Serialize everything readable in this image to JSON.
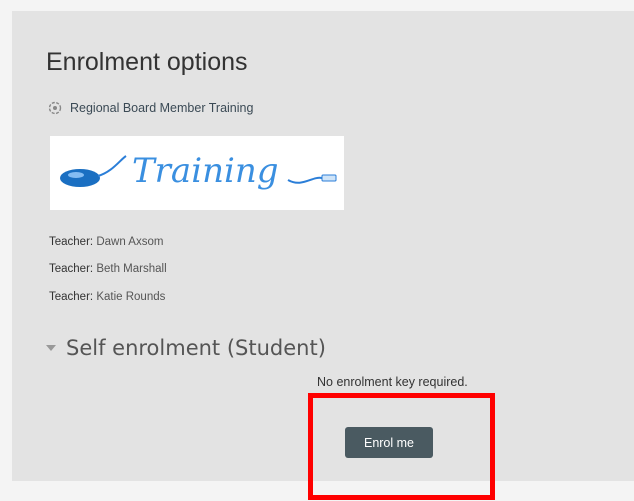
{
  "page": {
    "title": "Enrolment options"
  },
  "course": {
    "name": "Regional Board Member Training",
    "image_text": "Training"
  },
  "teachers": [
    {
      "role": "Teacher:",
      "name": "Dawn Axsom"
    },
    {
      "role": "Teacher:",
      "name": "Beth Marshall"
    },
    {
      "role": "Teacher:",
      "name": "Katie Rounds"
    }
  ],
  "self_enrolment": {
    "heading": "Self enrolment (Student)",
    "note": "No enrolment key required.",
    "button_label": "Enrol me"
  },
  "colors": {
    "button_bg": "#4a5a61",
    "highlight": "#ff0000",
    "panel_bg": "#e3e3e3"
  }
}
